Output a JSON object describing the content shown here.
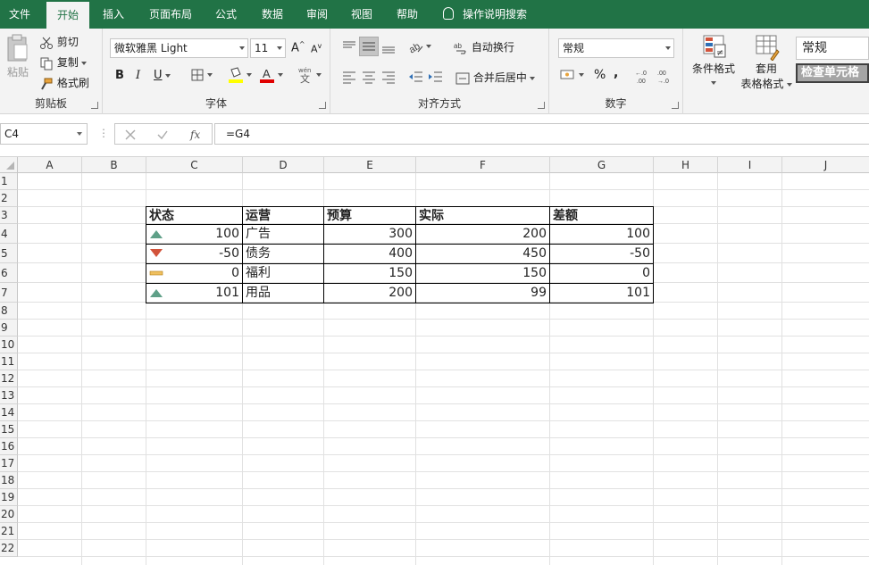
{
  "tabs": [
    "文件",
    "开始",
    "插入",
    "页面布局",
    "公式",
    "数据",
    "审阅",
    "视图",
    "帮助"
  ],
  "tell_me": "操作说明搜索",
  "clipboard": {
    "paste": "粘贴",
    "cut": "剪切",
    "copy": "复制",
    "format_painter": "格式刷",
    "label": "剪贴板"
  },
  "font": {
    "name": "微软雅黑 Light",
    "size": "11",
    "bold": "B",
    "italic": "I",
    "underline": "U",
    "grow": "A",
    "shrink": "A",
    "label": "字体"
  },
  "alignment": {
    "wrap_text": "自动换行",
    "merge_center": "合并后居中",
    "label": "对齐方式"
  },
  "number": {
    "format": "常规",
    "percent": "%",
    "comma": ",",
    "label": "数字"
  },
  "styles": {
    "conditional": "条件格式",
    "table_line1": "套用",
    "table_line2": "表格格式",
    "style_normal": "常规",
    "style_check": "检查单元格"
  },
  "name_box": "C4",
  "formula": "=G4",
  "columns": [
    "A",
    "B",
    "C",
    "D",
    "E",
    "F",
    "G",
    "H",
    "I",
    "J"
  ],
  "rows": [
    "1",
    "2",
    "3",
    "4",
    "5",
    "6",
    "7",
    "8",
    "9",
    "10",
    "11",
    "12",
    "13",
    "14",
    "15",
    "16",
    "17",
    "18",
    "19",
    "20",
    "21",
    "22"
  ],
  "table": {
    "headers": [
      "状态",
      "运营",
      "预算",
      "实际",
      "差额"
    ],
    "rows": [
      {
        "status": "100",
        "icon": "up",
        "name": "广告",
        "budget": "300",
        "actual": "200",
        "diff": "100"
      },
      {
        "status": "-50",
        "icon": "down",
        "name": "债务",
        "budget": "400",
        "actual": "450",
        "diff": "-50"
      },
      {
        "status": "0",
        "icon": "flat",
        "name": "福利",
        "budget": "150",
        "actual": "150",
        "diff": "0"
      },
      {
        "status": "101",
        "icon": "up",
        "name": "用品",
        "budget": "200",
        "actual": "99",
        "diff": "101"
      }
    ]
  },
  "colors": {
    "brand": "#217346",
    "up": "#5fa088",
    "down": "#d2533b",
    "flat": "#f0c060"
  }
}
